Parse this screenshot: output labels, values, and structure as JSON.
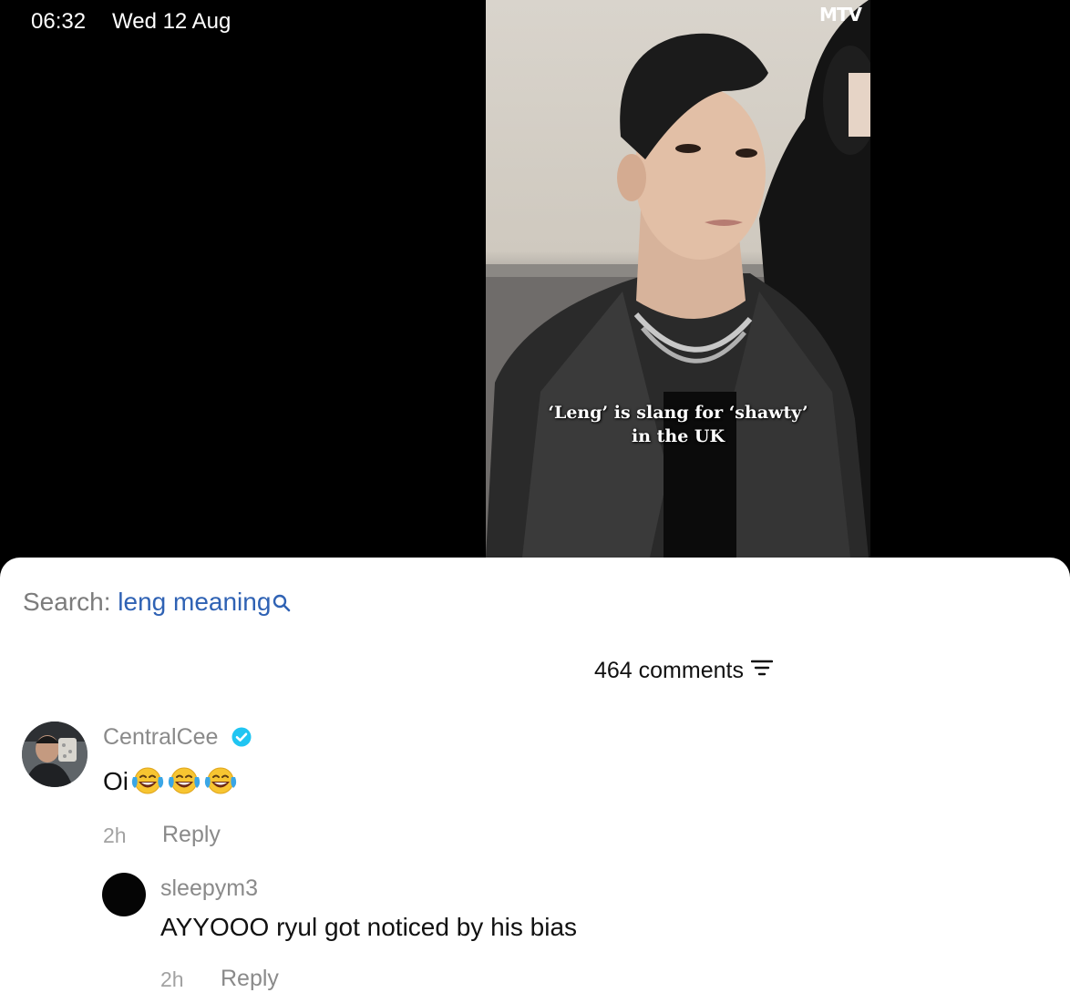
{
  "status_bar": {
    "time": "06:32",
    "date": "Wed 12 Aug"
  },
  "video": {
    "logo": "MTV",
    "caption_lines": [
      "‘Leng’ is slang for ‘shawty’",
      "in the UK"
    ]
  },
  "search": {
    "prefix": "Search: ",
    "query": "leng meaning",
    "icon": "search-icon"
  },
  "comments_header": {
    "count_label": "464 comments",
    "sort_icon": "sort-icon"
  },
  "comments": [
    {
      "username": "CentralCee",
      "verified": true,
      "text": "Oi",
      "emoji_count": 3,
      "emoji_name": "laughing-tears-emoji",
      "time": "2h",
      "reply_label": "Reply",
      "replies": [
        {
          "username": "sleepym3",
          "text": "AYYOOO ryul got noticed by his bias",
          "time": "2h",
          "reply_label": "Reply"
        }
      ]
    }
  ],
  "colors": {
    "search_query": "#2f62b4",
    "verified_badge": "#20c5f2",
    "muted_text": "#8a8a8a"
  }
}
